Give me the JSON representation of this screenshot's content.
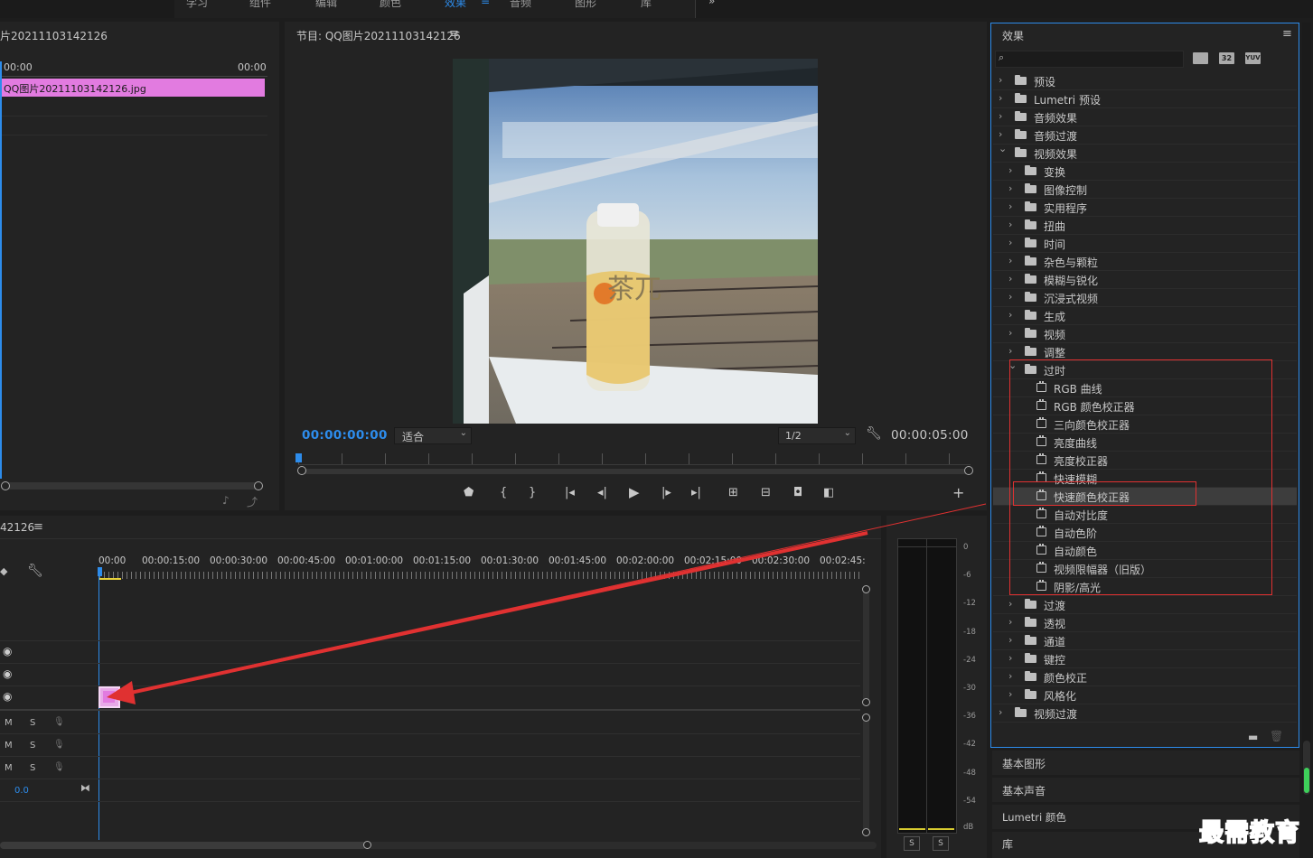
{
  "workspace_tabs": [
    "学习",
    "组件",
    "编辑",
    "颜色",
    "效果",
    "音频",
    "图形",
    "库"
  ],
  "workspace_active": "效果",
  "workspace_more": "»",
  "source": {
    "title": "片20211103142126",
    "time_start": "00:00",
    "time_end": "00:00",
    "clip_name": "QQ图片20211103142126.jpg"
  },
  "program": {
    "title": "节目: QQ图片20211103142126",
    "timecode": "00:00:00:00",
    "fit_label": "适合",
    "resolution": "1/2",
    "duration": "00:00:05:00",
    "bottle_text": "茶兀"
  },
  "timeline": {
    "title": "42126",
    "ruler": [
      "00:00",
      "00:00:15:00",
      "00:00:30:00",
      "00:00:45:00",
      "00:01:00:00",
      "00:01:15:00",
      "00:01:30:00",
      "00:01:45:00",
      "00:02:00:00",
      "00:02:15:00",
      "00:02:30:00",
      "00:02:45:"
    ],
    "audio_tracks": [
      {
        "m": "M",
        "s": "S"
      },
      {
        "m": "M",
        "s": "S"
      },
      {
        "m": "M",
        "s": "S"
      }
    ],
    "master_level": "0.0"
  },
  "meter": {
    "db_labels": [
      "0",
      "-6",
      "-12",
      "-18",
      "-24",
      "-30",
      "-36",
      "-42",
      "-48",
      "-54",
      "dB"
    ],
    "solo": [
      "S",
      "S"
    ]
  },
  "effects": {
    "title": "效果",
    "search_placeholder": "",
    "badges": [
      "32",
      "YUV"
    ],
    "items": [
      {
        "label": "预设",
        "level": 0,
        "open": false,
        "type": "preset"
      },
      {
        "label": "Lumetri 预设",
        "level": 0,
        "open": false,
        "type": "preset"
      },
      {
        "label": "音频效果",
        "level": 0,
        "open": false,
        "type": "folder"
      },
      {
        "label": "音频过渡",
        "level": 0,
        "open": false,
        "type": "folder"
      },
      {
        "label": "视频效果",
        "level": 0,
        "open": true,
        "type": "folder"
      },
      {
        "label": "变换",
        "level": 1,
        "open": false,
        "type": "folder"
      },
      {
        "label": "图像控制",
        "level": 1,
        "open": false,
        "type": "folder"
      },
      {
        "label": "实用程序",
        "level": 1,
        "open": false,
        "type": "folder"
      },
      {
        "label": "扭曲",
        "level": 1,
        "open": false,
        "type": "folder"
      },
      {
        "label": "时间",
        "level": 1,
        "open": false,
        "type": "folder"
      },
      {
        "label": "杂色与颗粒",
        "level": 1,
        "open": false,
        "type": "folder"
      },
      {
        "label": "模糊与锐化",
        "level": 1,
        "open": false,
        "type": "folder"
      },
      {
        "label": "沉浸式视频",
        "level": 1,
        "open": false,
        "type": "folder"
      },
      {
        "label": "生成",
        "level": 1,
        "open": false,
        "type": "folder"
      },
      {
        "label": "视频",
        "level": 1,
        "open": false,
        "type": "folder"
      },
      {
        "label": "调整",
        "level": 1,
        "open": false,
        "type": "folder"
      },
      {
        "label": "过时",
        "level": 1,
        "open": true,
        "type": "folder"
      },
      {
        "label": "RGB 曲线",
        "level": 2,
        "type": "effect"
      },
      {
        "label": "RGB 颜色校正器",
        "level": 2,
        "type": "effect"
      },
      {
        "label": "三向颜色校正器",
        "level": 2,
        "type": "effect"
      },
      {
        "label": "亮度曲线",
        "level": 2,
        "type": "effect"
      },
      {
        "label": "亮度校正器",
        "level": 2,
        "type": "effect"
      },
      {
        "label": "快速模糊",
        "level": 2,
        "type": "effect"
      },
      {
        "label": "快速颜色校正器",
        "level": 2,
        "type": "effect",
        "selected": true
      },
      {
        "label": "自动对比度",
        "level": 2,
        "type": "effect"
      },
      {
        "label": "自动色阶",
        "level": 2,
        "type": "effect"
      },
      {
        "label": "自动颜色",
        "level": 2,
        "type": "effect"
      },
      {
        "label": "视频限幅器（旧版）",
        "level": 2,
        "type": "effect"
      },
      {
        "label": "阴影/高光",
        "level": 2,
        "type": "effect"
      },
      {
        "label": "过渡",
        "level": 1,
        "open": false,
        "type": "folder"
      },
      {
        "label": "透视",
        "level": 1,
        "open": false,
        "type": "folder"
      },
      {
        "label": "通道",
        "level": 1,
        "open": false,
        "type": "folder"
      },
      {
        "label": "键控",
        "level": 1,
        "open": false,
        "type": "folder"
      },
      {
        "label": "颜色校正",
        "level": 1,
        "open": false,
        "type": "folder"
      },
      {
        "label": "风格化",
        "level": 1,
        "open": false,
        "type": "folder"
      },
      {
        "label": "视频过渡",
        "level": 0,
        "open": false,
        "type": "folder"
      }
    ]
  },
  "side_panels": [
    "基本图形",
    "基本声音",
    "Lumetri 颜色",
    "库"
  ],
  "watermark": "最需教育",
  "colors": {
    "accent": "#2d8ceb",
    "clip": "#e27be0",
    "highlight": "#e03131",
    "timecode": "#2d8ceb"
  }
}
